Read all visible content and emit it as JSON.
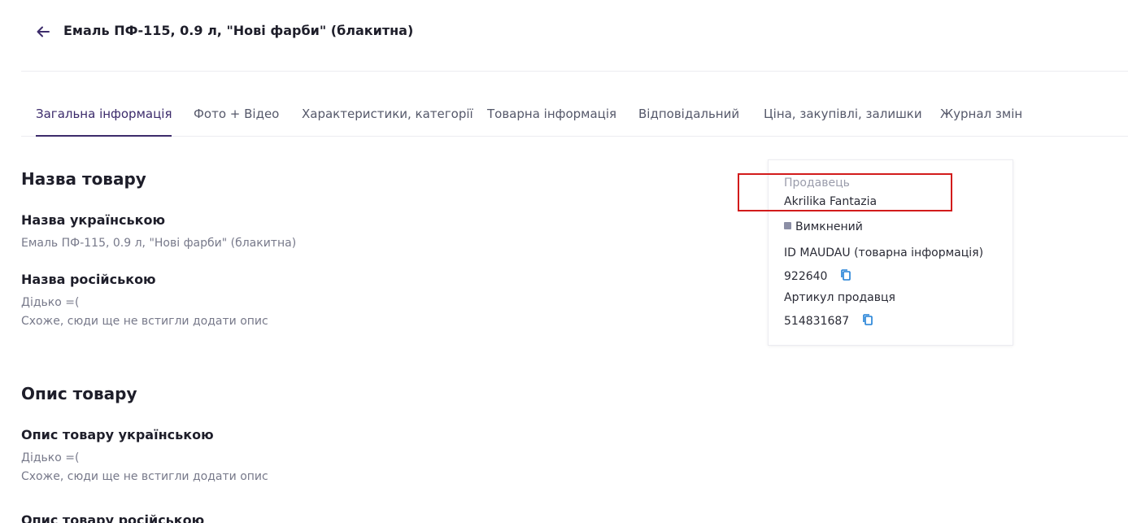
{
  "header": {
    "title": "Емаль ПФ-115, 0.9 л, \"Нові фарби\" (блакитна)",
    "back_icon": "arrow-left-icon"
  },
  "tabs": [
    {
      "label": "Загальна інформація",
      "active": true
    },
    {
      "label": "Фото + Відео"
    },
    {
      "label": "Характеристики, категорії"
    },
    {
      "label": "Товарна інформація"
    },
    {
      "label": "Відповідальний"
    },
    {
      "label": "Ціна, закупівлі, залишки"
    },
    {
      "label": "Журнал змін"
    }
  ],
  "name_section": {
    "title": "Назва товару",
    "ukrainian_label": "Назва українською",
    "ukrainian_value": "Емаль ПФ-115, 0.9 л, \"Нові фарби\" (блакитна)",
    "russian_label": "Назва російською",
    "russian_empty_line1": "Дідько =(",
    "russian_empty_line2": "Схоже, сюди ще не встигли додати опис"
  },
  "description_section": {
    "title": "Опис товару",
    "ukrainian_label": "Опис товару українською",
    "ukrainian_empty_line1": "Дідько =(",
    "ukrainian_empty_line2": "Схоже, сюди ще не встигли додати опис",
    "russian_label": "Опис товару російською"
  },
  "seller_card": {
    "seller_label": "Продавець",
    "seller_name": "Akrilika Fantazia",
    "status": "Вимкнений",
    "id_label": "ID MAUDAU (товарна інформація)",
    "id_value": "922640",
    "sku_label": "Артикул продавця",
    "sku_value": "514831687",
    "copy_icon": "copy-icon"
  },
  "colors": {
    "accent": "#3c2b6b",
    "highlight": "#d21b1b",
    "copy_icon": "#1e7fd6",
    "status_dot": "#8c8fa6"
  }
}
